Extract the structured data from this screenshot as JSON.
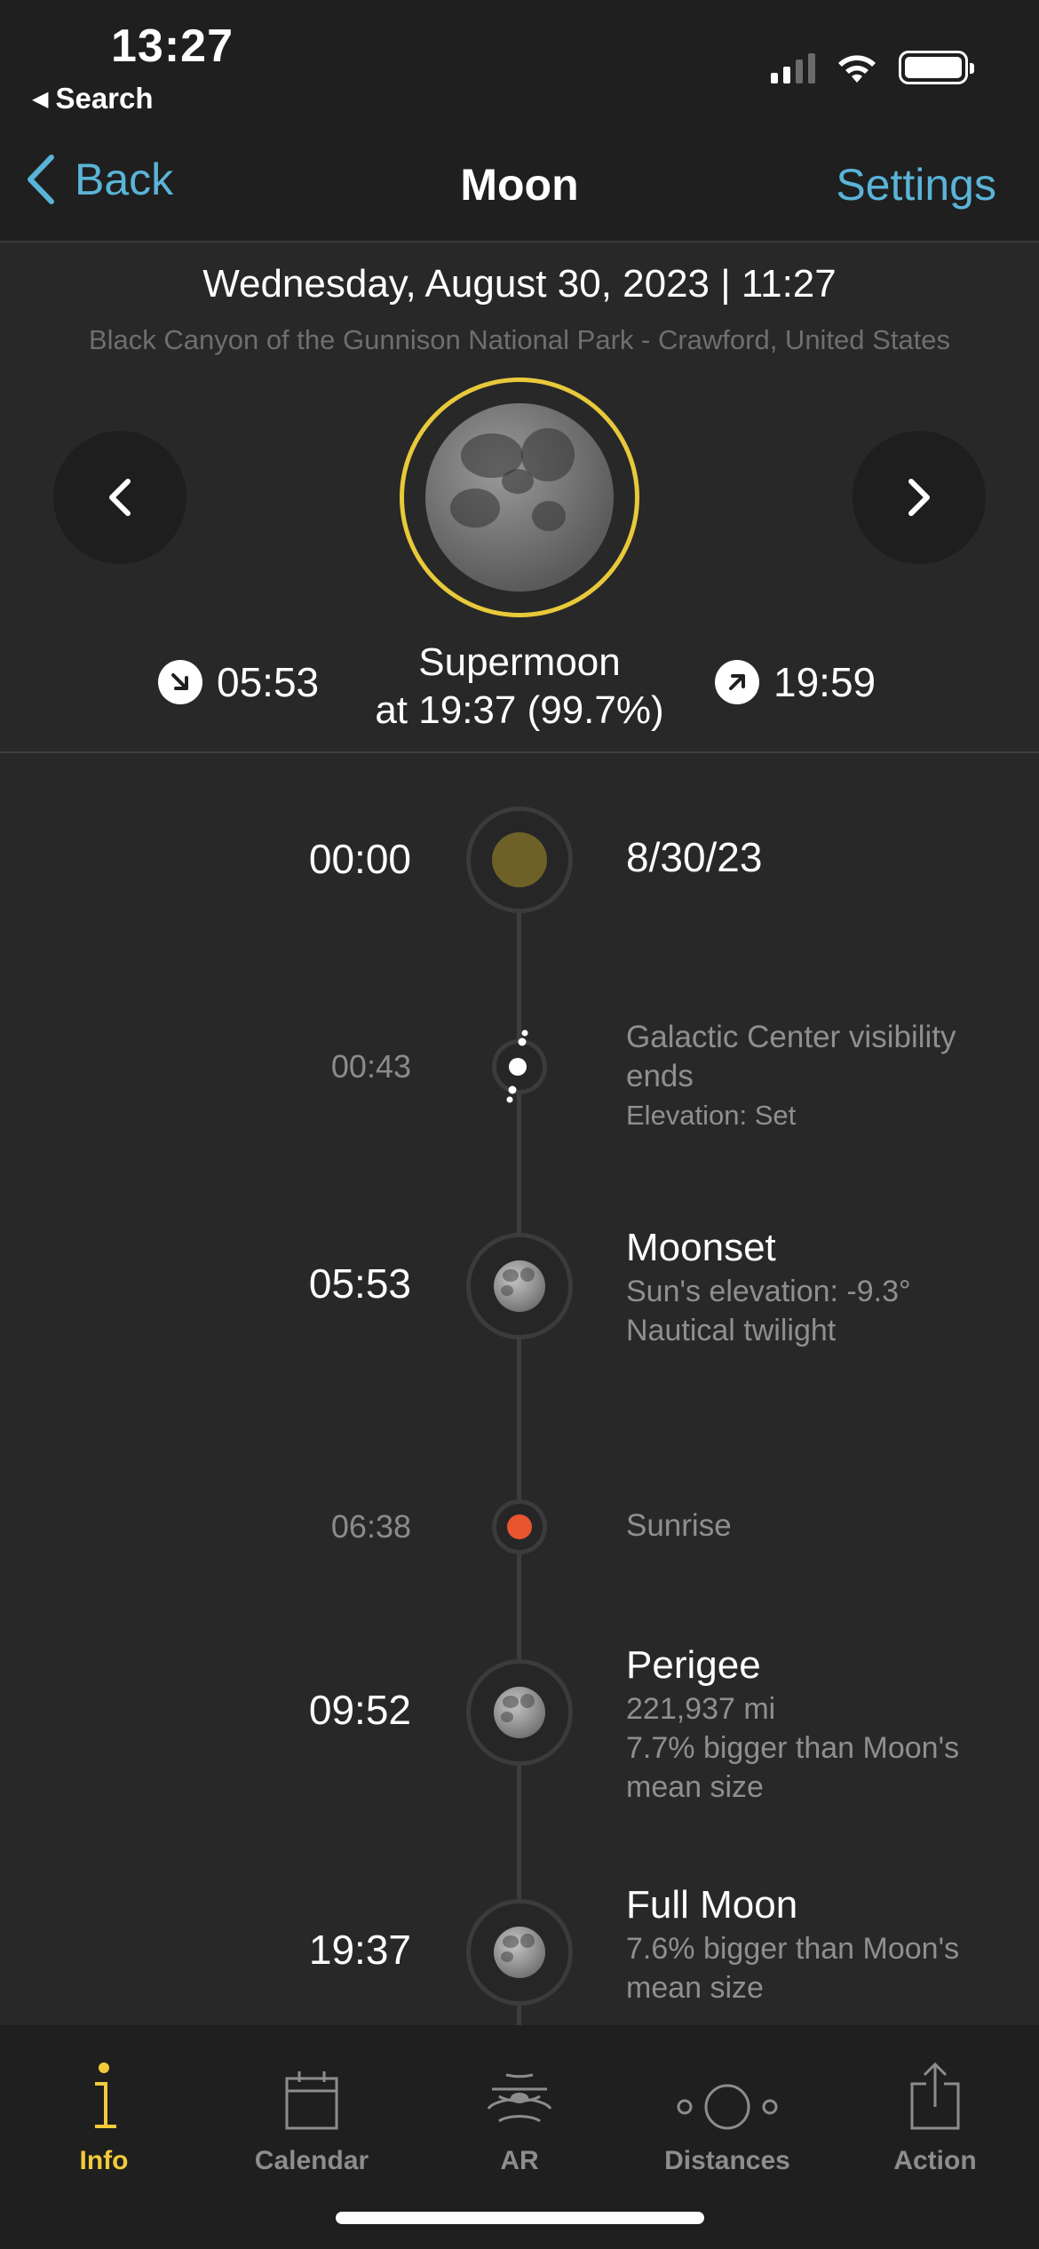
{
  "status_bar": {
    "time": "13:27",
    "back_app": "Search"
  },
  "nav": {
    "back_label": "Back",
    "title": "Moon",
    "settings_label": "Settings"
  },
  "header": {
    "date_line": "Wednesday, August 30, 2023 | 11:27",
    "location": "Black Canyon of the Gunnison National Park - Crawford, United States",
    "moonset_time": "05:53",
    "moonrise_time": "19:59",
    "phase_line1": "Supermoon",
    "phase_line2": "at 19:37 (99.7%)",
    "ring_color": "#e8c93a"
  },
  "timeline": [
    {
      "time": "00:00",
      "title": "8/30/23",
      "kind": "date"
    },
    {
      "time": "00:43",
      "title": "Galactic Center visibility ends",
      "sub": "Elevation: Set",
      "kind": "galactic"
    },
    {
      "time": "05:53",
      "title": "Moonset",
      "sub1": "Sun's elevation: -9.3°",
      "sub2": "Nautical twilight",
      "kind": "moon"
    },
    {
      "time": "06:38",
      "title": "Sunrise",
      "kind": "sun"
    },
    {
      "time": "09:52",
      "title": "Perigee",
      "sub1": "221,937 mi",
      "sub2": "7.7% bigger than Moon's mean size",
      "kind": "moon"
    },
    {
      "time": "19:37",
      "title": "Full Moon",
      "sub1": "7.6% bigger than Moon's mean size",
      "kind": "moon"
    }
  ],
  "tabs": [
    {
      "label": "Info",
      "icon": "info-icon",
      "active": true
    },
    {
      "label": "Calendar",
      "icon": "calendar-icon",
      "active": false
    },
    {
      "label": "AR",
      "icon": "ar-icon",
      "active": false
    },
    {
      "label": "Distances",
      "icon": "distances-icon",
      "active": false
    },
    {
      "label": "Action",
      "icon": "share-icon",
      "active": false
    }
  ],
  "colors": {
    "accent": "#5ab4d8",
    "active_tab": "#f1cb3b",
    "sunrise": "#e8552f"
  }
}
